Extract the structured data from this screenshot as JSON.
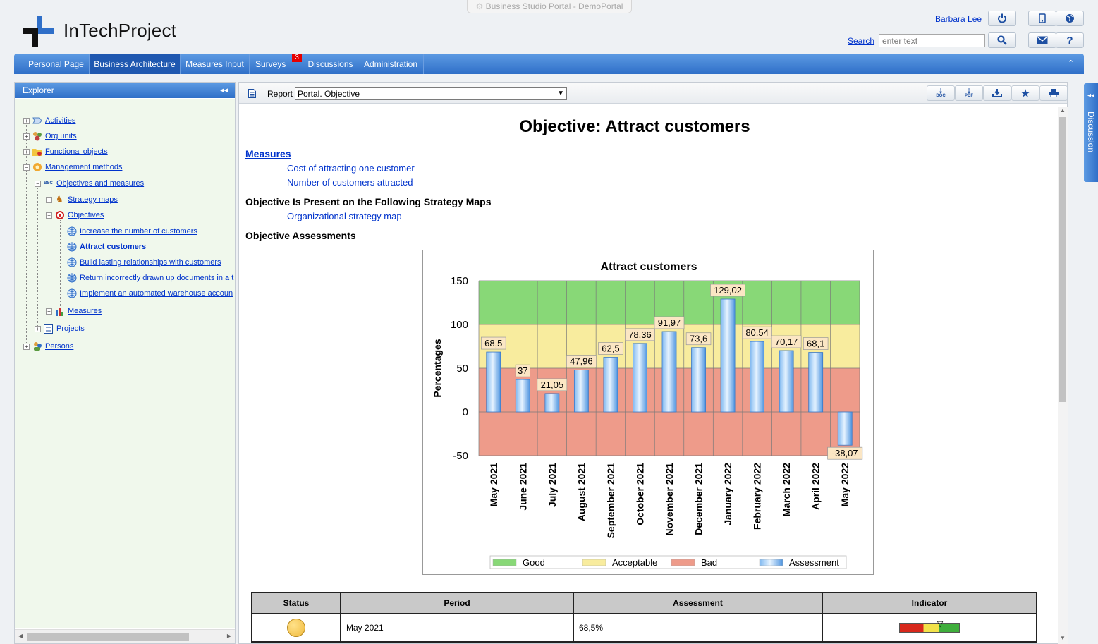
{
  "window": {
    "title": "Business Studio Portal - DemoPortal"
  },
  "header": {
    "logo_text": "InTechProject",
    "user_name": "Barbara Lee",
    "search_label": "Search",
    "search_placeholder": "enter text"
  },
  "nav": {
    "items": [
      {
        "label": "Personal Page"
      },
      {
        "label": "Business Architecture"
      },
      {
        "label": "Measures Input"
      },
      {
        "label": "Surveys"
      },
      {
        "label": "Discussions"
      },
      {
        "label": "Administration"
      }
    ],
    "surveys_badge": "3",
    "active": "Business Architecture"
  },
  "explorer": {
    "title": "Explorer",
    "items": [
      {
        "label": "Activities"
      },
      {
        "label": "Org units"
      },
      {
        "label": "Functional objects"
      },
      {
        "label": "Management methods"
      },
      {
        "label": "Objectives and measures"
      },
      {
        "label": "Strategy maps"
      },
      {
        "label": "Objectives"
      },
      {
        "label": "Increase the number of customers"
      },
      {
        "label": "Attract customers"
      },
      {
        "label": "Build lasting relationships with customers"
      },
      {
        "label": "Return incorrectly drawn up documents in a t"
      },
      {
        "label": "Implement an automated warehouse accoun"
      },
      {
        "label": "Measures"
      },
      {
        "label": "Projects"
      },
      {
        "label": "Persons"
      }
    ]
  },
  "report": {
    "label": "Report",
    "selected": "Portal. Objective",
    "buttons": [
      "DOC",
      "PDF"
    ],
    "title": "Objective: Attract customers",
    "measures_heading": "Measures",
    "measures": [
      "Cost of attracting one customer",
      "Number of customers attracted"
    ],
    "dash": "–",
    "maps_heading": "Objective Is Present on the Following Strategy Maps",
    "maps": [
      "Organizational strategy map"
    ],
    "assessments_heading": "Objective Assessments"
  },
  "side_tab": {
    "label": "Discussion"
  },
  "chart_data": {
    "type": "bar",
    "title": "Attract customers",
    "ylabel": "Percentages",
    "ylim": [
      -50,
      150
    ],
    "yticks": [
      "150",
      "100",
      "50",
      "0",
      "-50"
    ],
    "categories": [
      "May 2021",
      "June 2021",
      "July 2021",
      "August 2021",
      "September 2021",
      "October 2021",
      "November 2021",
      "December 2021",
      "January 2022",
      "February 2022",
      "March 2022",
      "April 2022",
      "May 2022"
    ],
    "series": [
      {
        "name": "Assessment",
        "values": [
          68.5,
          37,
          21.05,
          47.96,
          62.5,
          78.36,
          91.97,
          73.6,
          129.02,
          80.54,
          70.17,
          68.1,
          -38.07
        ]
      }
    ],
    "value_labels": [
      "68,5",
      "37",
      "21,05",
      "47,96",
      "62,5",
      "78,36",
      "91,97",
      "73,6",
      "129,02",
      "80,54",
      "70,17",
      "68,1",
      "-38,07"
    ],
    "bands": [
      {
        "name": "Good",
        "from": 100,
        "to": 150,
        "color": "#88d877"
      },
      {
        "name": "Acceptable",
        "from": 50,
        "to": 100,
        "color": "#f8ec9e"
      },
      {
        "name": "Bad",
        "from": -50,
        "to": 50,
        "color": "#ee9b8a"
      }
    ],
    "legend": [
      "Good",
      "Acceptable",
      "Bad",
      "Assessment"
    ],
    "legend_position": "bottom",
    "grid": true
  },
  "table": {
    "headers": [
      "Status",
      "Period",
      "Assessment",
      "Indicator"
    ],
    "rows": [
      {
        "period": "May 2021",
        "assessment": "68,5%",
        "status_color": "#f0b93c",
        "indicator_level": 0.685
      }
    ]
  }
}
